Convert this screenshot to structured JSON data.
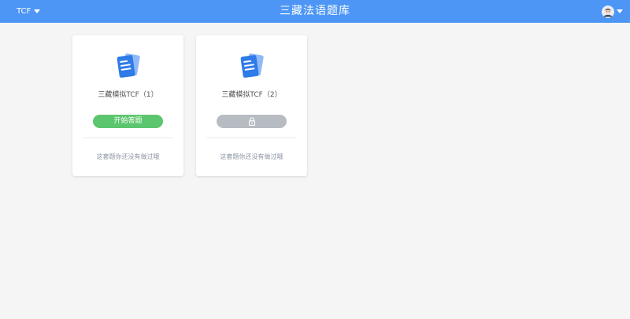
{
  "header": {
    "exam_selector": "TCF",
    "app_title": "三藏法语题库"
  },
  "colors": {
    "header_bg": "#4d96f6",
    "start_button": "#5cc66e",
    "locked_button": "#b7bcc2"
  },
  "papers": [
    {
      "title": "三藏模拟TCF（1）",
      "action_label": "开始答题",
      "locked": false,
      "status": "这套题你还没有做过哦",
      "icon": "document-icon"
    },
    {
      "title": "三藏模拟TCF（2）",
      "action_label": "",
      "locked": true,
      "status": "这套题你还没有做过哦",
      "icon": "document-icon"
    }
  ]
}
